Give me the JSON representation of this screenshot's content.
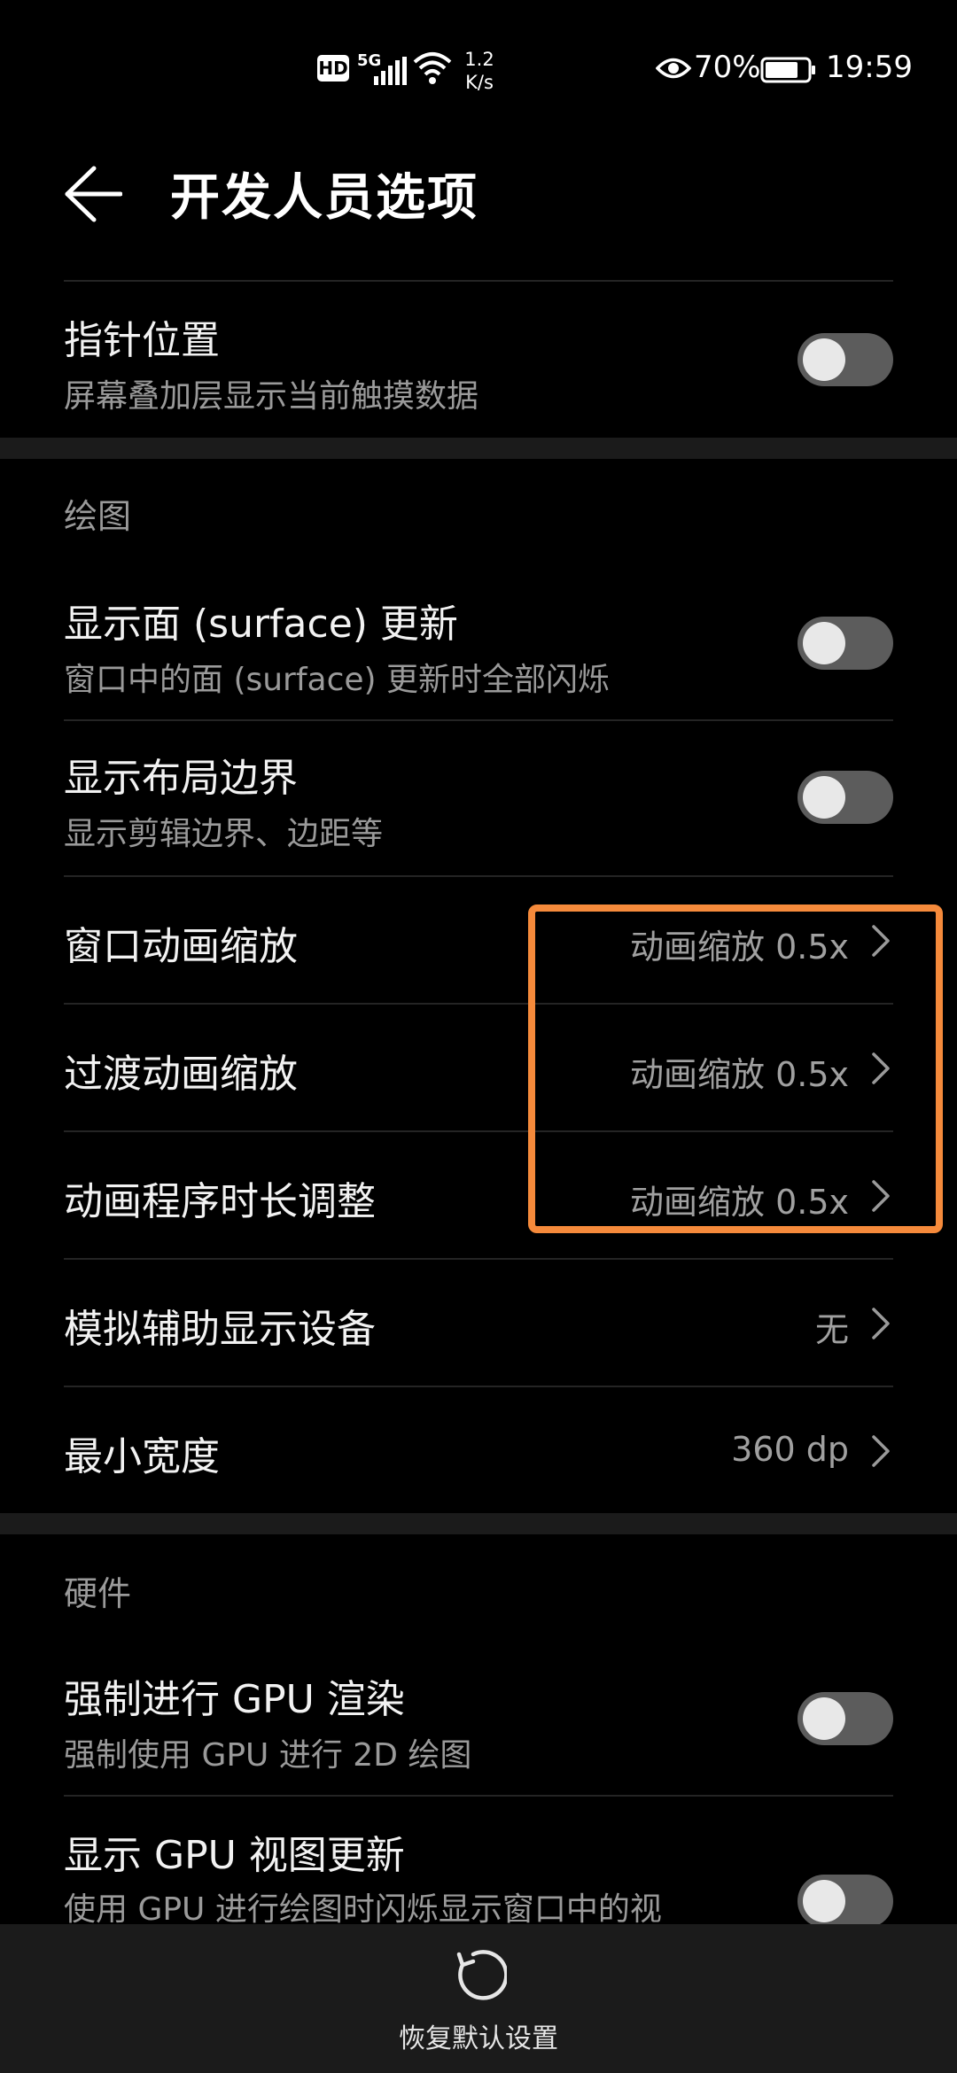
{
  "status_bar": {
    "hd_badge": "HD",
    "network": "5G",
    "speed_value": "1.2",
    "speed_unit": "K/s",
    "battery_percent": "70%",
    "time": "19:59"
  },
  "header": {
    "title": "开发人员选项",
    "back_icon": "back-arrow-icon"
  },
  "rows": {
    "pointer_location": {
      "title": "指针位置",
      "subtitle": "屏幕叠加层显示当前触摸数据",
      "toggle_on": false
    },
    "show_surface_updates": {
      "title": "显示面 (surface) 更新",
      "subtitle": "窗口中的面 (surface) 更新时全部闪烁",
      "toggle_on": false
    },
    "show_layout_bounds": {
      "title": "显示布局边界",
      "subtitle": "显示剪辑边界、边距等",
      "toggle_on": false
    },
    "window_animation_scale": {
      "title": "窗口动画缩放",
      "value": "动画缩放 0.5x"
    },
    "transition_animation_scale": {
      "title": "过渡动画缩放",
      "value": "动画缩放 0.5x"
    },
    "animator_duration_scale": {
      "title": "动画程序时长调整",
      "value": "动画缩放 0.5x"
    },
    "simulate_secondary_display": {
      "title": "模拟辅助显示设备",
      "value": "无"
    },
    "smallest_width": {
      "title": "最小宽度",
      "value": "360 dp"
    },
    "force_gpu_rendering": {
      "title": "强制进行 GPU 渲染",
      "subtitle": "强制使用 GPU 进行 2D 绘图",
      "toggle_on": false
    },
    "show_gpu_view_updates": {
      "title": "显示 GPU 视图更新",
      "subtitle": "使用 GPU 进行绘图时闪烁显示窗口中的视",
      "toggle_on": false
    }
  },
  "sections": {
    "drawing": "绘图",
    "hardware": "硬件"
  },
  "bottom_bar": {
    "reset_label": "恢复默认设置",
    "reset_icon": "reset-icon"
  },
  "colors": {
    "background": "#000000",
    "highlight": "#f58a3b",
    "toggle_track": "#5c5c5c",
    "toggle_knob": "#e8e8e8",
    "secondary_text": "#9a9a9a"
  }
}
